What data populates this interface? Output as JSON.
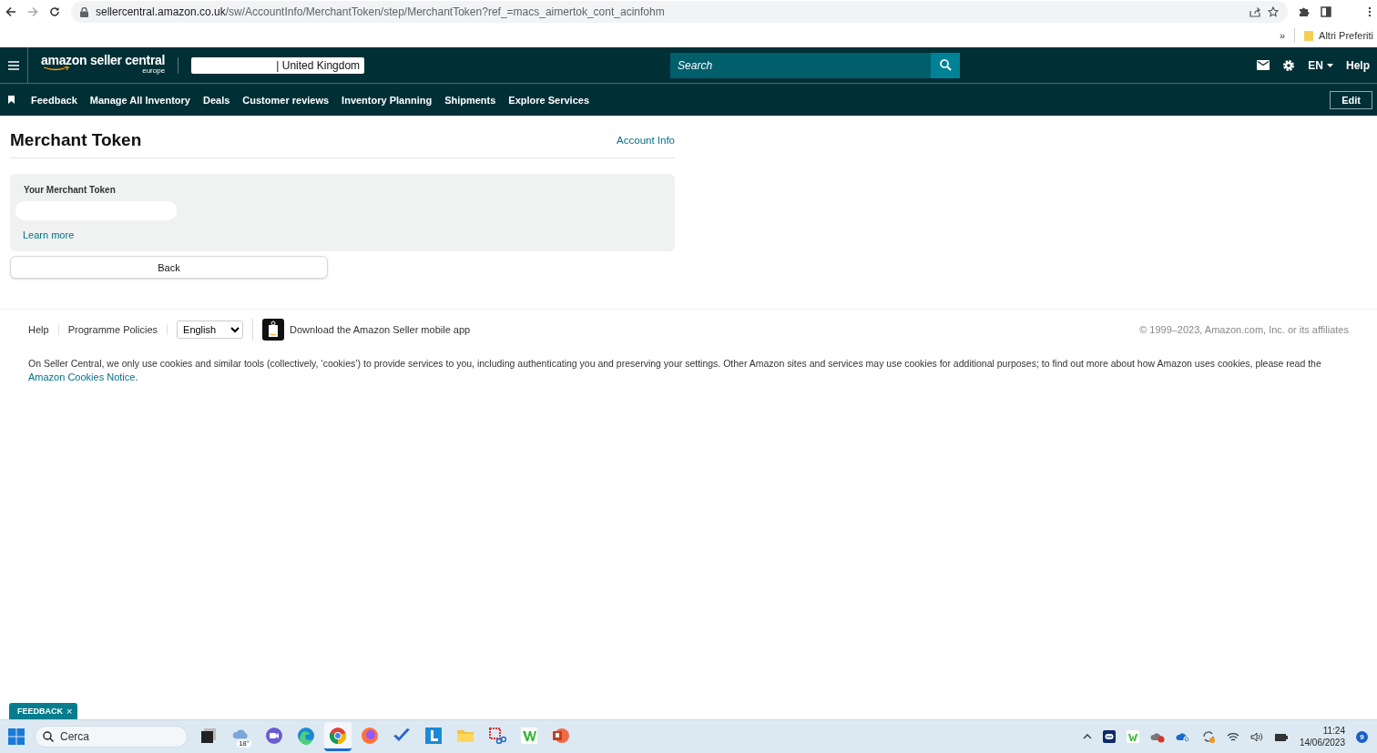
{
  "browser": {
    "url_host": "sellercentral.amazon.co.uk",
    "url_path": "/sw/AccountInfo/MerchantToken/step/MerchantToken?ref_=macs_aimertok_cont_acinfohm",
    "bookmarks_overflow": "»",
    "bookmark_folder": "Altri Preferiti"
  },
  "header": {
    "logo_text": "amazon seller central",
    "logo_region": "europe",
    "marketplace": "| United Kingdom",
    "search_placeholder": "Search",
    "language": "EN",
    "help": "Help"
  },
  "nav": {
    "items": [
      "Feedback",
      "Manage All Inventory",
      "Deals",
      "Customer reviews",
      "Inventory Planning",
      "Shipments",
      "Explore Services"
    ],
    "edit": "Edit"
  },
  "page": {
    "title": "Merchant Token",
    "account_link": "Account Info",
    "token_label": "Your Merchant Token",
    "learn_more": "Learn more",
    "back": "Back"
  },
  "footer": {
    "links": [
      "Help",
      "Programme Policies"
    ],
    "language": "English",
    "app_link": "Download the Amazon Seller mobile app",
    "copyright": "© 1999–2023, Amazon.com, Inc. or its affiliates",
    "cookie_text": "On Seller Central, we only use cookies and similar tools (collectively, ‘cookies’) to provide services to you, including authenticating you and preserving your settings. Other Amazon sites and services may use cookies for additional purposes; to find out more about how Amazon uses cookies, please read the",
    "cookie_link": "Amazon Cookies Notice",
    "cookie_end": "."
  },
  "feedback_tab": {
    "label": "FEEDBACK",
    "close": "×"
  },
  "taskbar": {
    "search_placeholder": "Cerca",
    "weather": "18°",
    "apps": [
      {
        "kind": "taskview",
        "selected": false
      },
      {
        "kind": "weather",
        "selected": false
      },
      {
        "kind": "chat",
        "selected": false
      },
      {
        "kind": "edge",
        "selected": false
      },
      {
        "kind": "chrome",
        "selected": true
      },
      {
        "kind": "firefox",
        "selected": false
      },
      {
        "kind": "todo",
        "selected": false
      },
      {
        "kind": "lblue",
        "selected": false
      },
      {
        "kind": "files",
        "selected": false
      },
      {
        "kind": "snip",
        "selected": false
      },
      {
        "kind": "wgreen",
        "selected": false
      },
      {
        "kind": "powerpoint",
        "selected": false
      }
    ],
    "time": "11:24",
    "date": "14/06/2023",
    "notifications": "9"
  }
}
